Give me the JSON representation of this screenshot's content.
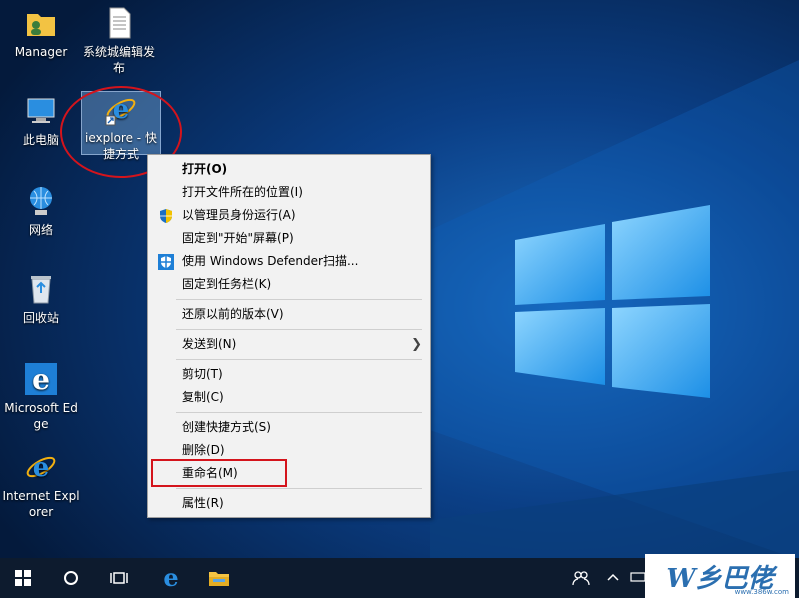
{
  "desktop": {
    "icons": [
      {
        "label": "Manager",
        "icon": "user-folder-icon"
      },
      {
        "label": "系统城编辑发布",
        "icon": "text-document-icon"
      },
      {
        "label": "此电脑",
        "icon": "computer-icon"
      },
      {
        "label": "iexplore - 快捷方式",
        "icon": "internet-explorer-icon"
      },
      {
        "label": "网络",
        "icon": "network-icon"
      },
      {
        "label": "回收站",
        "icon": "recycle-bin-icon"
      },
      {
        "label": "Microsoft Edge",
        "icon": "edge-icon"
      },
      {
        "label": "Internet Explorer",
        "icon": "internet-explorer-icon"
      }
    ]
  },
  "context_menu": {
    "items": [
      {
        "label": "打开(O)",
        "bold": true
      },
      {
        "label": "打开文件所在的位置(I)"
      },
      {
        "label": "以管理员身份运行(A)",
        "icon": "uac-shield-icon"
      },
      {
        "label": "固定到\"开始\"屏幕(P)"
      },
      {
        "label": "使用 Windows Defender扫描...",
        "icon": "defender-shield-icon"
      },
      {
        "label": "固定到任务栏(K)"
      },
      {
        "label": "还原以前的版本(V)"
      },
      {
        "label": "发送到(N)",
        "submenu": true
      },
      {
        "label": "剪切(T)"
      },
      {
        "label": "复制(C)"
      },
      {
        "label": "创建快捷方式(S)"
      },
      {
        "label": "删除(D)"
      },
      {
        "label": "重命名(M)",
        "highlighted": true
      },
      {
        "label": "属性(R)"
      }
    ]
  },
  "taskbar": {
    "buttons": [
      "windows-start-icon",
      "cortana-search-icon",
      "task-view-icon",
      "edge-icon",
      "file-explorer-icon"
    ],
    "tray": [
      "people-icon",
      "chevron-up-icon",
      "battery-icon"
    ]
  },
  "watermark": {
    "text": "W乡巴佬",
    "sub": "www.386w.com"
  },
  "colors": {
    "annotation": "#d4141c",
    "accent": "#0078d7"
  }
}
